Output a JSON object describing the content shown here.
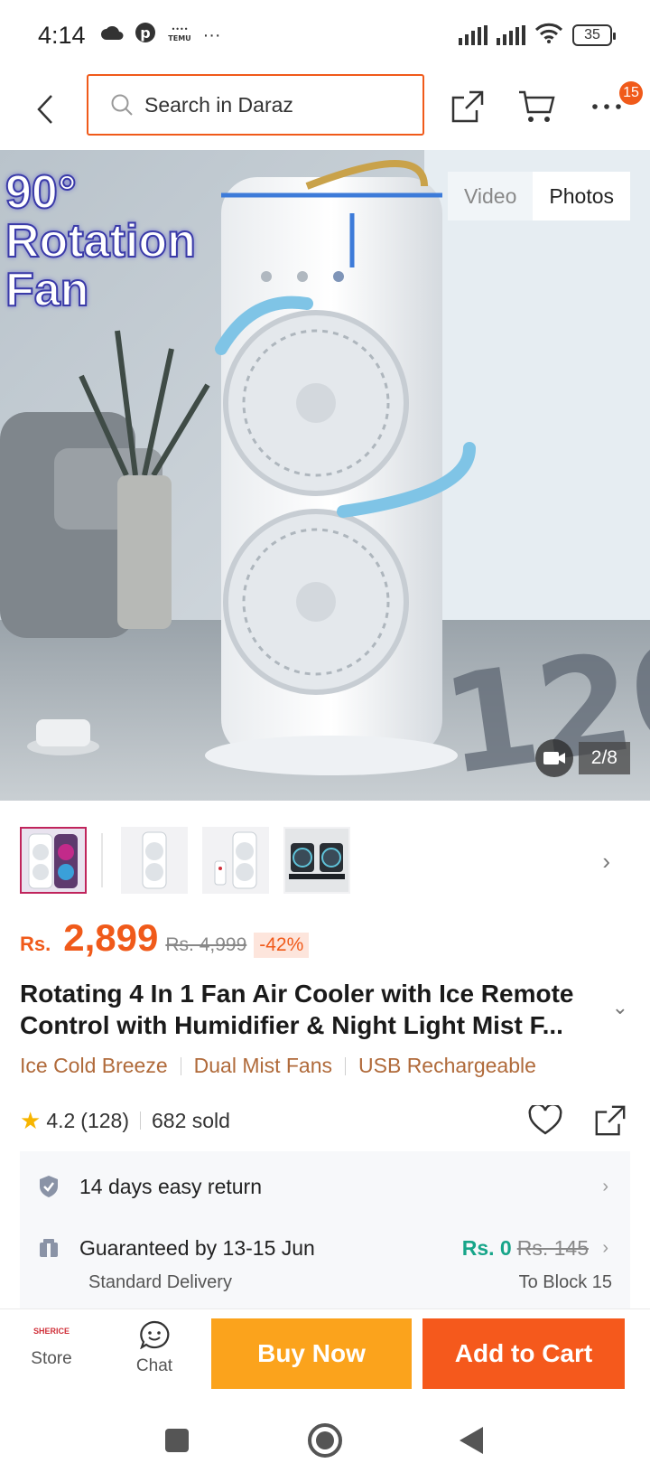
{
  "status_bar": {
    "time": "4:14",
    "notification_icons": [
      "cloud-icon",
      "pinterest-icon",
      "temu-icon"
    ],
    "more_indicator": "···",
    "battery": "35"
  },
  "header": {
    "search_placeholder": "Search in Daraz",
    "cart_badge": "15"
  },
  "gallery": {
    "tabs": [
      "Video",
      "Photos"
    ],
    "active_tab": "Photos",
    "promo_line1": "90°",
    "promo_line2": "Rotation",
    "promo_line3": "Fan",
    "counter": "2/8",
    "thumbnail_count": 4
  },
  "product": {
    "currency": "Rs.",
    "price": "2,899",
    "original_price": "Rs. 4,999",
    "discount": "-42%",
    "title": "Rotating 4 In 1 Fan Air Cooler with Ice Remote Control with Humidifier & Night Light Mist F...",
    "tags": [
      "Ice Cold Breeze",
      "Dual Mist Fans",
      "USB Rechargeable"
    ],
    "rating": "4.2",
    "reviews": "(128)",
    "sold": "682 sold"
  },
  "service": {
    "return_text": "14 days easy return",
    "delivery_text": "Guaranteed by 13-15 Jun",
    "delivery_type": "Standard Delivery",
    "shipping_fee": "Rs. 0",
    "shipping_fee_old": "Rs. 145",
    "ship_to": "To Block 15"
  },
  "bottom_bar": {
    "store_logo_text": "SHERICE",
    "store_label": "Store",
    "chat_label": "Chat",
    "buy_now": "Buy Now",
    "add_to_cart": "Add to Cart"
  },
  "colors": {
    "accent": "#f05a1a",
    "buy_now": "#fba31c",
    "add_to_cart": "#f5591c",
    "tag_text": "#b06a3a",
    "free_shipping": "#17a589"
  }
}
